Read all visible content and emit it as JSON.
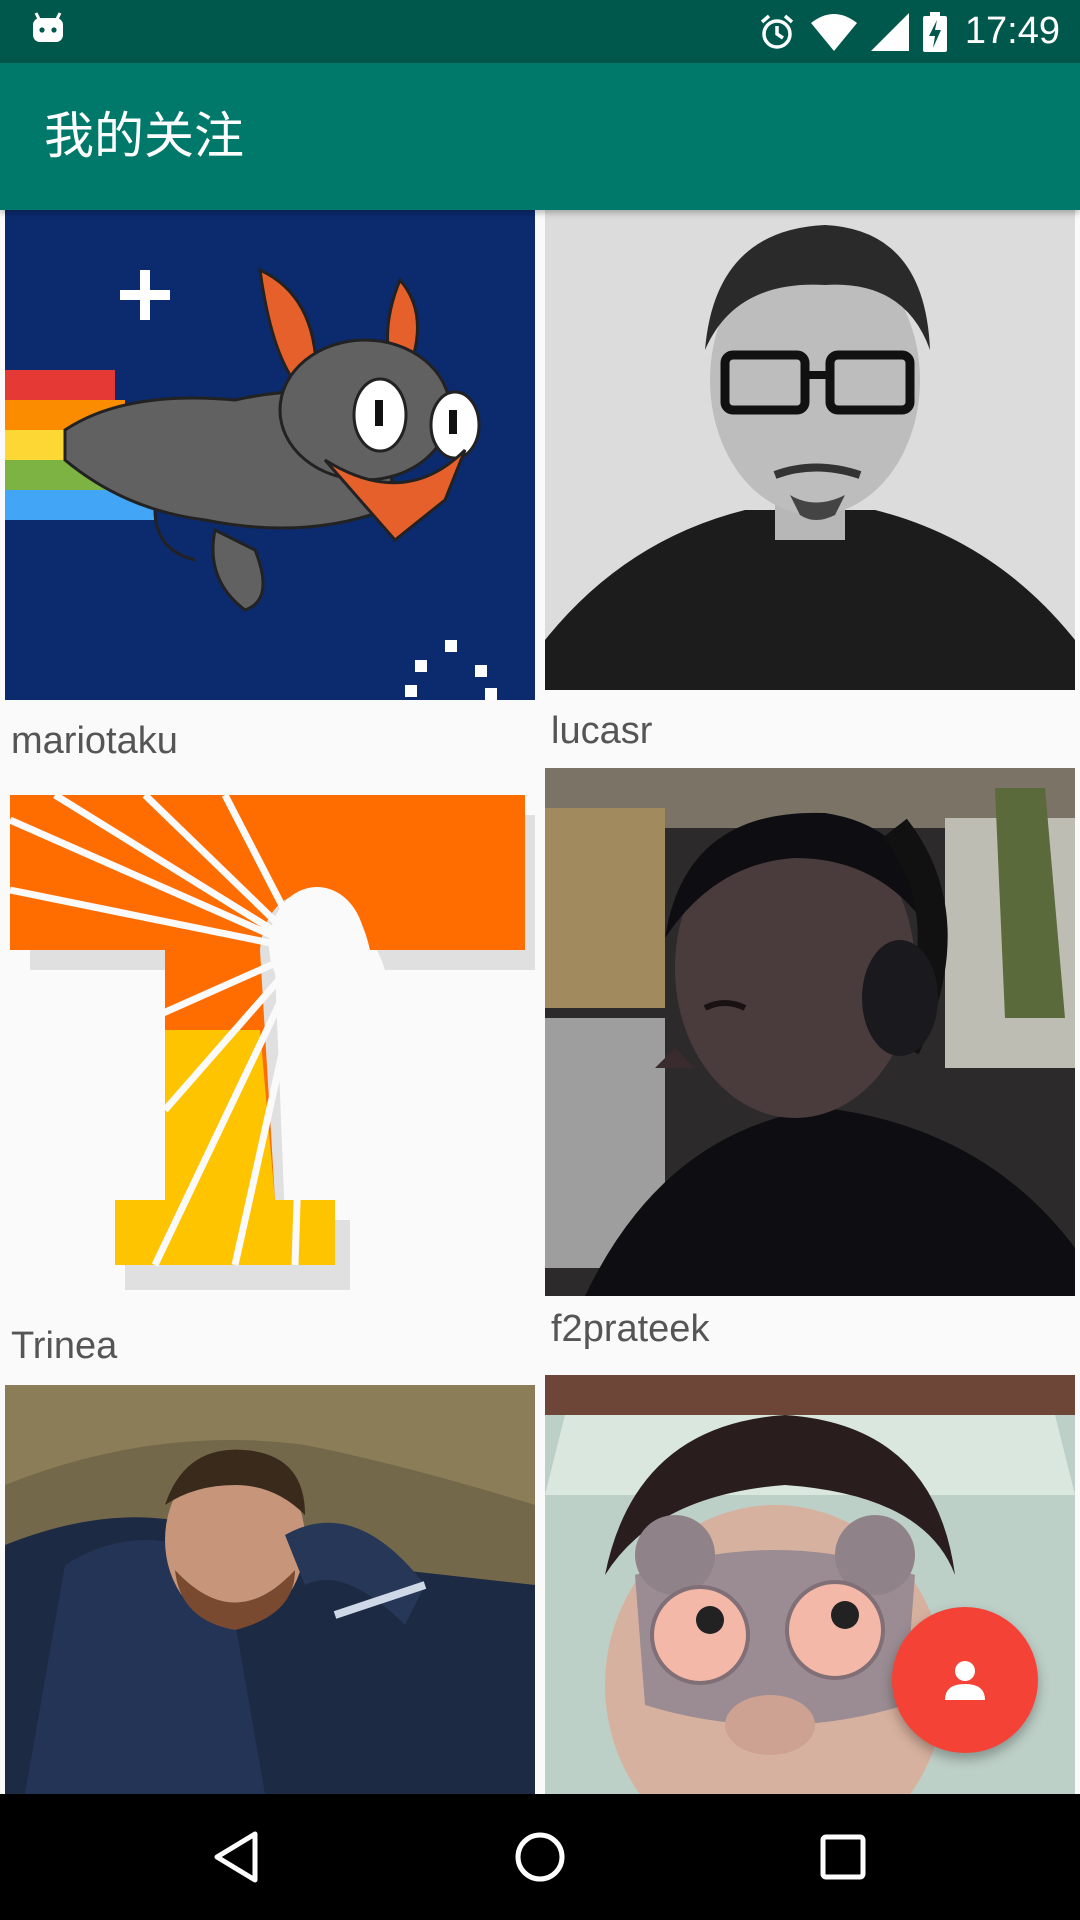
{
  "status_bar": {
    "time": "17:49",
    "icons": [
      "android-icon",
      "alarm-icon",
      "wifi-icon",
      "signal-icon",
      "battery-charging-icon"
    ]
  },
  "app_bar": {
    "title": "我的关注"
  },
  "following": [
    {
      "username": "mariotaku",
      "avatar": "nyan-cat-style illustration"
    },
    {
      "username": "lucasr",
      "avatar": "grayscale portrait with glasses"
    },
    {
      "username": "Trinea",
      "avatar": "orange and yellow T logo"
    },
    {
      "username": "f2prateek",
      "avatar": "portrait with headphones"
    },
    {
      "username": "",
      "avatar": "man in dark jacket by rock"
    },
    {
      "username": "",
      "avatar": "person wearing plush sleep mask"
    }
  ],
  "fab": {
    "icon": "person-icon"
  },
  "nav_bar": {
    "icons": [
      "back-icon",
      "home-icon",
      "recents-icon"
    ]
  },
  "colors": {
    "status_bar": "#00574b",
    "app_bar": "#00796b",
    "fab": "#f44336",
    "background": "#fafafa"
  }
}
